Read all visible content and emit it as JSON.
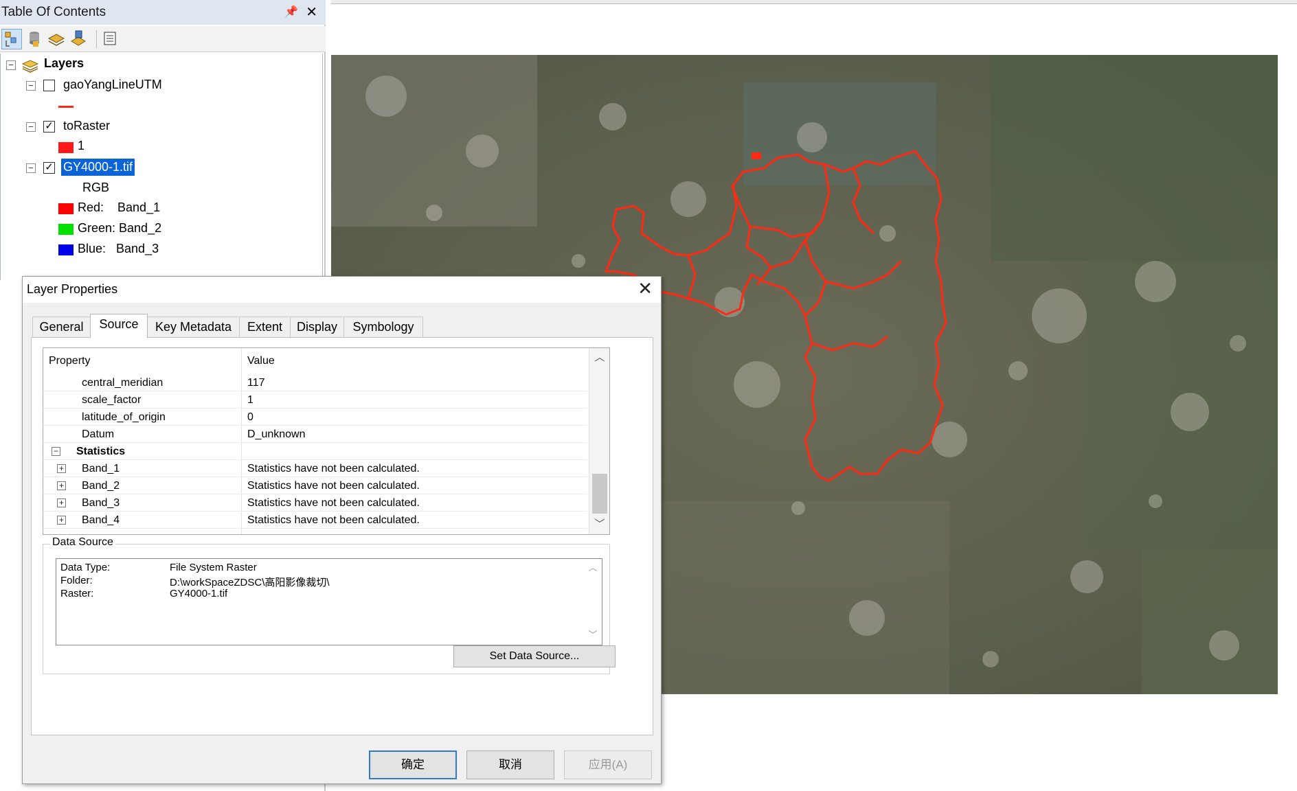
{
  "toc": {
    "title": "Table Of Contents",
    "pin_glyph": "⫫",
    "close_glyph": "✕",
    "toolbar": {
      "buttons": [
        "list-by-drawing-order-icon",
        "list-by-source-icon",
        "list-by-visibility-icon",
        "list-by-selection-icon",
        "options-icon"
      ]
    },
    "tree": {
      "root_label": "Layers",
      "layers": [
        {
          "name": "gaoYangLineUTM",
          "checked": false,
          "legend": [
            {
              "type": "line",
              "color": "#ff2a1a",
              "label": ""
            }
          ]
        },
        {
          "name": "toRaster",
          "checked": true,
          "legend": [
            {
              "type": "fill",
              "color": "#ff1a1a",
              "label": "1"
            }
          ]
        },
        {
          "name": "GY4000-1.tif",
          "checked": true,
          "selected": true,
          "rgb_label": "RGB",
          "legend": [
            {
              "type": "fill",
              "color": "#ff0000",
              "label": "Red:    Band_1"
            },
            {
              "type": "fill",
              "color": "#00e000",
              "label": "Green: Band_2"
            },
            {
              "type": "fill",
              "color": "#0000e6",
              "label": "Blue:   Band_3"
            }
          ]
        }
      ]
    }
  },
  "dialog": {
    "title": "Layer Properties",
    "close_glyph": "✕",
    "tabs": [
      "General",
      "Source",
      "Key Metadata",
      "Extent",
      "Display",
      "Symbology"
    ],
    "active_tab": "Source",
    "grid": {
      "headers": [
        "Property",
        "Value"
      ],
      "rows": [
        {
          "property": "central_meridian",
          "value": "117"
        },
        {
          "property": "scale_factor",
          "value": "1"
        },
        {
          "property": "latitude_of_origin",
          "value": "0"
        },
        {
          "property": "Datum",
          "value": "D_unknown"
        }
      ],
      "section": "Statistics",
      "bands": [
        {
          "property": "Band_1",
          "value": "Statistics have not been calculated."
        },
        {
          "property": "Band_2",
          "value": "Statistics have not been calculated."
        },
        {
          "property": "Band_3",
          "value": "Statistics have not been calculated."
        },
        {
          "property": "Band_4",
          "value": "Statistics have not been calculated."
        }
      ]
    },
    "data_source": {
      "legend": "Data Source",
      "data_type_label": "Data Type:",
      "data_type_value": "File System Raster",
      "folder_label": "Folder:",
      "folder_value": "D:\\workSpaceZDSC\\高阳影像裁切\\",
      "raster_label": "Raster:",
      "raster_value": "GY4000-1.tif",
      "set_button": "Set Data Source..."
    },
    "buttons": {
      "ok": "确定",
      "cancel": "取消",
      "apply": "应用(A)"
    }
  },
  "map": {
    "boundary_color": "#ff2a14"
  },
  "colors": {
    "accent": "#2f7ad1",
    "selection": "#0a64d8"
  }
}
